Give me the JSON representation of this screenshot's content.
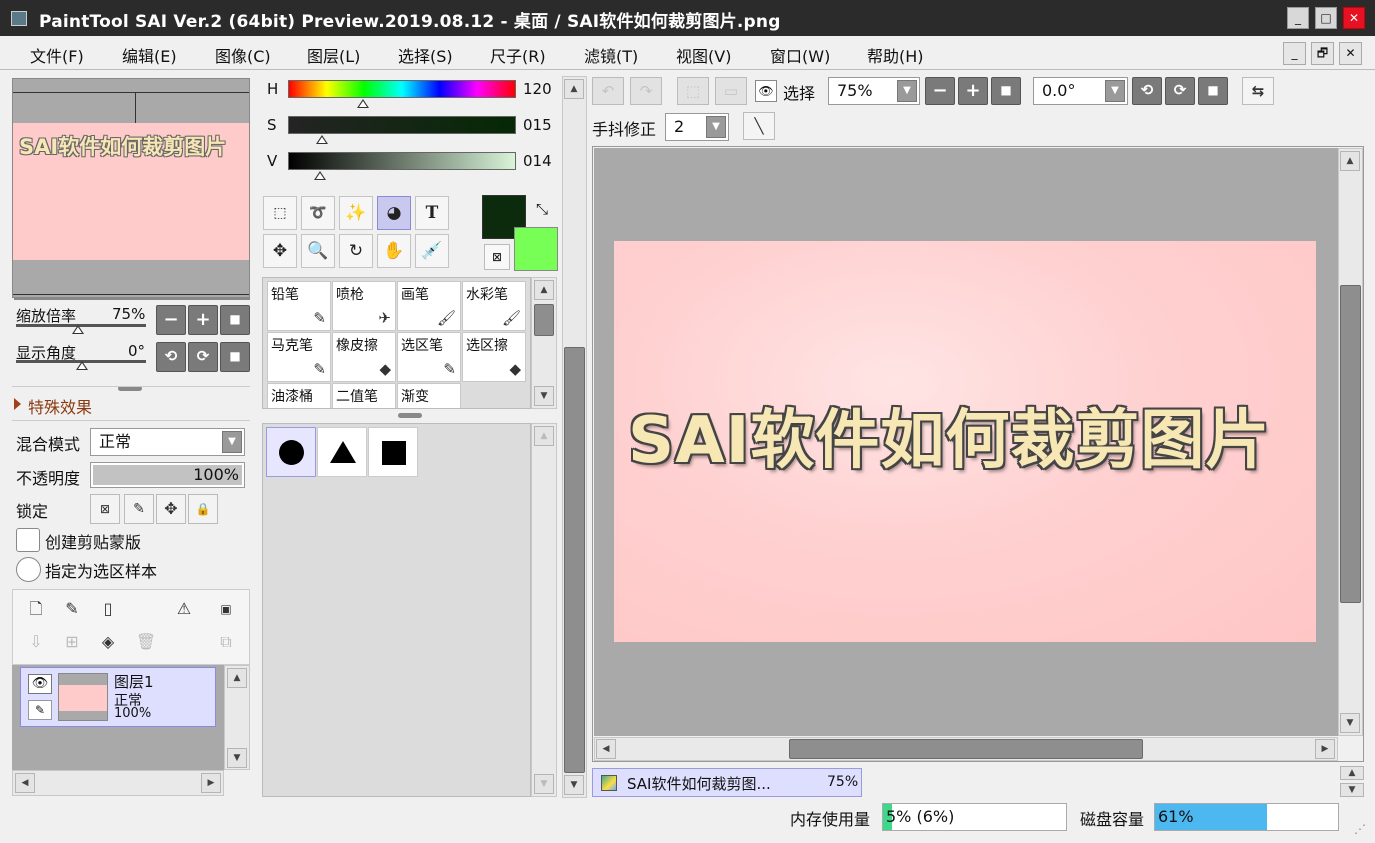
{
  "window": {
    "title": "PaintTool SAI Ver.2 (64bit) Preview.2019.08.12 - 桌面 / SAI软件如何裁剪图片.png",
    "min": "_",
    "max": "□",
    "close": "✕"
  },
  "menu": [
    {
      "label": "文件(F)"
    },
    {
      "label": "编辑(E)"
    },
    {
      "label": "图像(C)"
    },
    {
      "label": "图层(L)"
    },
    {
      "label": "选择(S)"
    },
    {
      "label": "尺子(R)"
    },
    {
      "label": "滤镜(T)"
    },
    {
      "label": "视图(V)"
    },
    {
      "label": "窗口(W)"
    },
    {
      "label": "帮助(H)"
    }
  ],
  "mdi": {
    "min": "_",
    "restore": "🗗",
    "close": "✕"
  },
  "navigator": {
    "preview_text": "SAI软件如何裁剪图片",
    "zoom_label": "缩放倍率",
    "zoom_value": "75%",
    "angle_label": "显示角度",
    "angle_value": "0°",
    "zoom_minus": "−",
    "zoom_plus": "+",
    "zoom_reset": "■",
    "rot_ccw": "⟲",
    "rot_cw": "⟳",
    "rot_reset": "■"
  },
  "layer_props": {
    "effects_label": "特殊效果",
    "blend_label": "混合模式",
    "blend_value": "正常",
    "opacity_label": "不透明度",
    "opacity_value": "100%",
    "opacity_pct": 100,
    "lock_label": "锁定",
    "clip_label": "创建剪贴蒙版",
    "sample_label": "指定为选区样本"
  },
  "layers": [
    {
      "name": "图层1",
      "mode": "正常",
      "opacity": "100%"
    }
  ],
  "color": {
    "h_label": "H",
    "h_value": "120",
    "h_pct": 0.33,
    "s_label": "S",
    "s_value": "015",
    "s_pct": 0.15,
    "v_label": "V",
    "v_value": "014",
    "v_pct": 0.14,
    "primary": "#0c2a0c",
    "secondary": "#77ff55"
  },
  "brushes": [
    {
      "name": "铅笔",
      "icon": "pencil-icon",
      "glyph": "✎"
    },
    {
      "name": "喷枪",
      "icon": "airbrush-icon",
      "glyph": "✈"
    },
    {
      "name": "画笔",
      "icon": "brush-icon",
      "glyph": "🖌"
    },
    {
      "name": "水彩笔",
      "icon": "watercolor-icon",
      "glyph": "🖌"
    },
    {
      "name": "马克笔",
      "icon": "marker-icon",
      "glyph": "✎"
    },
    {
      "name": "橡皮擦",
      "icon": "eraser-icon",
      "glyph": "◆"
    },
    {
      "name": "选区笔",
      "icon": "select-pen-icon",
      "glyph": "✎"
    },
    {
      "name": "选区擦",
      "icon": "select-eraser-icon",
      "glyph": "◆"
    },
    {
      "name": "油漆桶",
      "icon": "",
      "glyph": ""
    },
    {
      "name": "二值笔",
      "icon": "",
      "glyph": ""
    },
    {
      "name": "渐变",
      "icon": "",
      "glyph": ""
    }
  ],
  "toolbar": {
    "select_label": "选择",
    "zoom_value": "75%",
    "angle_value": "0.0°",
    "stabilizer_label": "手抖修正",
    "stabilizer_value": "2"
  },
  "canvas_text": "SAI软件如何裁剪图片",
  "doc_tab": {
    "name": "SAI软件如何裁剪图...",
    "zoom": "75%"
  },
  "status": {
    "memory_label": "内存使用量",
    "memory_value": "5% (6%)",
    "memory_pct": 5,
    "disk_label": "磁盘容量",
    "disk_value": "61%",
    "disk_pct": 61,
    "accent_memory": "#3fd88a",
    "accent_disk": "#4db8f0"
  }
}
